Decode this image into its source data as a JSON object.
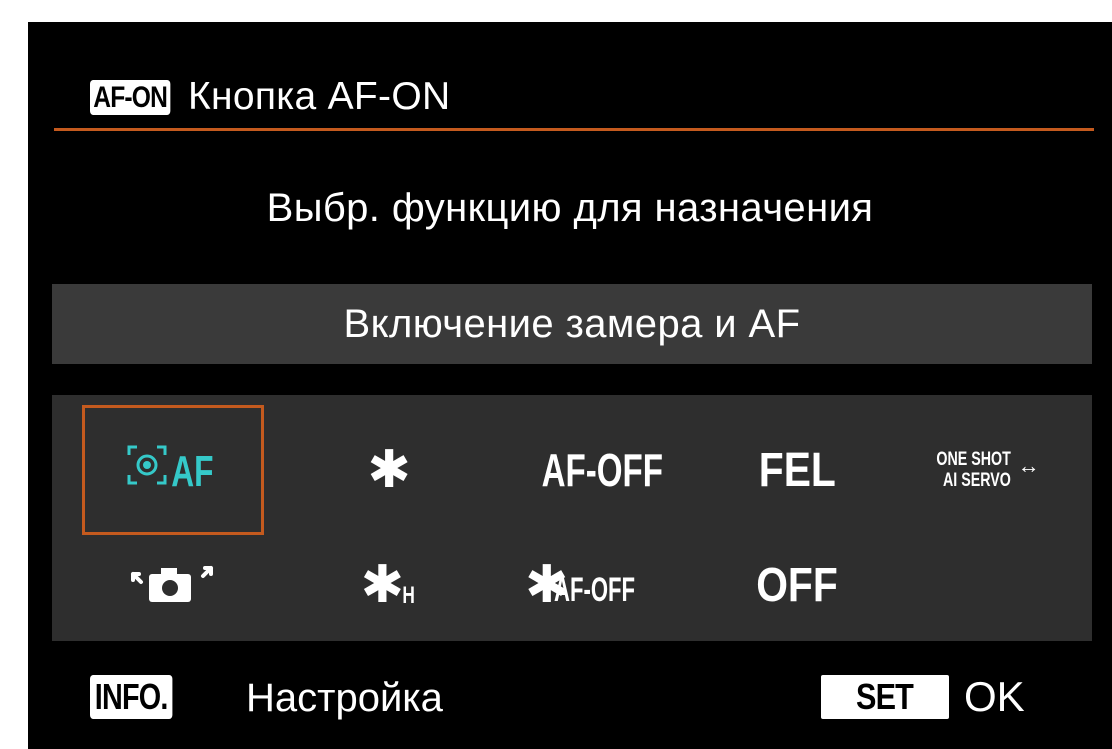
{
  "header": {
    "badge": "AF-ON",
    "title": "Кнопка AF-ON"
  },
  "prompt": "Выбр. функцию для назначения",
  "selected_function": "Включение замера и AF",
  "grid": {
    "row1": [
      {
        "id": "metering-af",
        "label": "AF",
        "icon": "metering-af-icon",
        "selected": true
      },
      {
        "id": "ae-lock",
        "label": "✱",
        "icon": "ae-lock-icon",
        "selected": false
      },
      {
        "id": "af-off",
        "label": "AF-OFF",
        "selected": false
      },
      {
        "id": "fel",
        "label": "FEL",
        "selected": false
      },
      {
        "id": "oneshot-aiservo",
        "line1": "ONE SHOT",
        "line2": "AI SERVO",
        "arrow": "↔",
        "selected": false
      }
    ],
    "row2": [
      {
        "id": "camera-rotate",
        "icon": "camera-exchange-icon",
        "selected": false
      },
      {
        "id": "ae-lock-hold",
        "label": "✱",
        "sub": "H",
        "selected": false
      },
      {
        "id": "ae-lock-af-off",
        "label": "✱",
        "sub": "AF-OFF",
        "selected": false
      },
      {
        "id": "off",
        "label": "OFF",
        "selected": false
      }
    ]
  },
  "footer": {
    "info_badge": "INFO.",
    "info_label": "Настройка",
    "set_badge": "SET",
    "set_label": "OK"
  },
  "colors": {
    "accent": "#c45a1e",
    "panel": "#2e2e2e",
    "bar": "#3a3a3a",
    "af_icon": "#35c9c9"
  }
}
